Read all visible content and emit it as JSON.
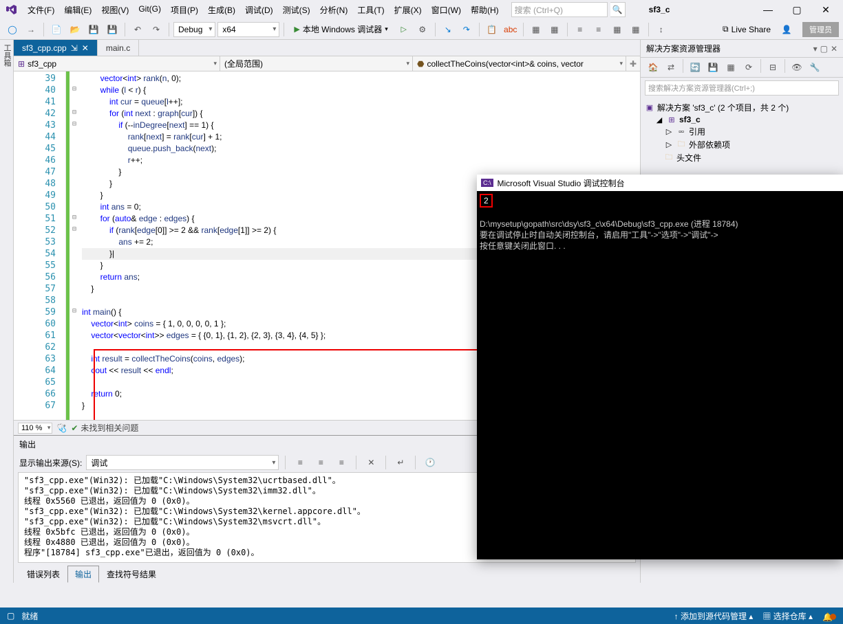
{
  "title": {
    "project": "sf3_c"
  },
  "menu": [
    "文件(F)",
    "编辑(E)",
    "视图(V)",
    "Git(G)",
    "项目(P)",
    "生成(B)",
    "调试(D)",
    "测试(S)",
    "分析(N)",
    "工具(T)",
    "扩展(X)",
    "窗口(W)",
    "帮助(H)"
  ],
  "search": {
    "placeholder": "搜索 (Ctrl+Q)"
  },
  "toolbar": {
    "config": "Debug",
    "platform": "x64",
    "run": "本地 Windows 调试器",
    "liveshare": "Live Share",
    "admin": "管理员"
  },
  "left_tool": "工具箱",
  "tabs": [
    {
      "name": "sf3_cpp.cpp",
      "active": true,
      "pin": "⇲"
    },
    {
      "name": "main.c",
      "active": false
    }
  ],
  "nav": {
    "scope": "sf3_cpp",
    "global": "(全局范围)",
    "func": "collectTheCoins(vector<int>& coins, vector"
  },
  "lines": {
    "start": 39,
    "end": 67
  },
  "code": [
    {
      "n": 39,
      "t": "        vector<int> rank(n, 0);",
      "f": ""
    },
    {
      "n": 40,
      "t": "        while (l < r) {",
      "f": "⊟"
    },
    {
      "n": 41,
      "t": "            int cur = queue[l++];",
      "f": ""
    },
    {
      "n": 42,
      "t": "            for (int next : graph[cur]) {",
      "f": "⊟"
    },
    {
      "n": 43,
      "t": "                if (--inDegree[next] == 1) {",
      "f": "⊟"
    },
    {
      "n": 44,
      "t": "                    rank[next] = rank[cur] + 1;",
      "f": ""
    },
    {
      "n": 45,
      "t": "                    queue.push_back(next);",
      "f": ""
    },
    {
      "n": 46,
      "t": "                    r++;",
      "f": ""
    },
    {
      "n": 47,
      "t": "                }",
      "f": ""
    },
    {
      "n": 48,
      "t": "            }",
      "f": ""
    },
    {
      "n": 49,
      "t": "        }",
      "f": ""
    },
    {
      "n": 50,
      "t": "        int ans = 0;",
      "f": ""
    },
    {
      "n": 51,
      "t": "        for (auto& edge : edges) {",
      "f": "⊟"
    },
    {
      "n": 52,
      "t": "            if (rank[edge[0]] >= 2 && rank[edge[1]] >= 2) {",
      "f": "⊟"
    },
    {
      "n": 53,
      "t": "                ans += 2;",
      "f": ""
    },
    {
      "n": 54,
      "t": "            }|",
      "f": "",
      "hl": true
    },
    {
      "n": 55,
      "t": "        }",
      "f": ""
    },
    {
      "n": 56,
      "t": "        return ans;",
      "f": ""
    },
    {
      "n": 57,
      "t": "    }",
      "f": ""
    },
    {
      "n": 58,
      "t": "",
      "f": ""
    },
    {
      "n": 59,
      "t": "int main() {",
      "f": "⊟"
    },
    {
      "n": 60,
      "t": "    vector<int> coins = { 1, 0, 0, 0, 0, 1 };",
      "f": ""
    },
    {
      "n": 61,
      "t": "    vector<vector<int>> edges = { {0, 1}, {1, 2}, {2, 3}, {3, 4}, {4, 5} };",
      "f": ""
    },
    {
      "n": 62,
      "t": "",
      "f": ""
    },
    {
      "n": 63,
      "t": "    int result = collectTheCoins(coins, edges);",
      "f": ""
    },
    {
      "n": 64,
      "t": "    cout << result << endl;",
      "f": ""
    },
    {
      "n": 65,
      "t": "",
      "f": ""
    },
    {
      "n": 66,
      "t": "    return 0;",
      "f": ""
    },
    {
      "n": 67,
      "t": "}",
      "f": ""
    }
  ],
  "zoom": "110 %",
  "issues": "未找到相关问题",
  "output": {
    "title": "输出",
    "source_label": "显示输出来源(S):",
    "source": "调试",
    "lines": [
      "\"sf3_cpp.exe\"(Win32): 已加载\"C:\\Windows\\System32\\ucrtbased.dll\"。",
      "\"sf3_cpp.exe\"(Win32): 已加载\"C:\\Windows\\System32\\imm32.dll\"。",
      "线程 0x5560 已退出，返回值为 0 (0x0)。",
      "\"sf3_cpp.exe\"(Win32): 已加载\"C:\\Windows\\System32\\kernel.appcore.dll\"。",
      "\"sf3_cpp.exe\"(Win32): 已加载\"C:\\Windows\\System32\\msvcrt.dll\"。",
      "线程 0x5bfc 已退出，返回值为 0 (0x0)。",
      "线程 0x4880 已退出，返回值为 0 (0x0)。",
      "程序\"[18784] sf3_cpp.exe\"已退出，返回值为 0 (0x0)。"
    ]
  },
  "bottom_tabs": [
    "错误列表",
    "输出",
    "查找符号结果"
  ],
  "solution": {
    "title": "解决方案资源管理器",
    "search": "搜索解决方案资源管理器(Ctrl+;)",
    "root": "解决方案 'sf3_c' (2 个项目，共 2 个)",
    "proj": "sf3_c",
    "refs": "引用",
    "ext": "外部依赖项",
    "hdr": "头文件"
  },
  "status": {
    "ready": "就绪",
    "src": "添加到源代码管理",
    "repo": "选择仓库"
  },
  "console": {
    "title": "Microsoft Visual Studio 调试控制台",
    "out": "2",
    "path": "D:\\mysetup\\gopath\\src\\dsy\\sf3_c\\x64\\Debug\\sf3_cpp.exe (进程 18784)",
    "msg1": "要在调试停止时自动关闭控制台，请启用\"工具\"->\"选项\"->\"调试\"->",
    "msg2": "按任意键关闭此窗口. . ."
  }
}
